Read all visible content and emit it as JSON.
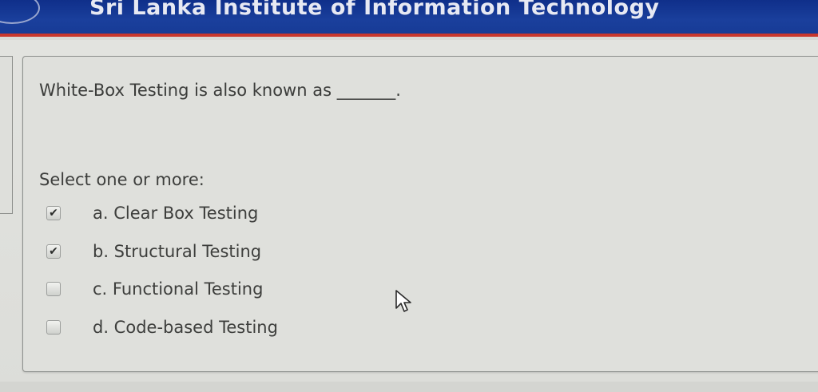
{
  "header": {
    "title": "Sri Lanka Institute of Information Technology"
  },
  "question": {
    "text": "White-Box Testing is also known as _______."
  },
  "answer": {
    "prompt": "Select one or more:",
    "options": [
      {
        "label": "a. Clear Box Testing",
        "checked": true
      },
      {
        "label": "b. Structural Testing",
        "checked": true
      },
      {
        "label": "c. Functional Testing",
        "checked": false
      },
      {
        "label": "d. Code-based Testing",
        "checked": false
      }
    ]
  },
  "colors": {
    "header_bg": "#1a3f9c",
    "header_accent": "#c8372d",
    "card_bg": "#dfe0dc"
  },
  "icons": {
    "checkmark": "checkmark-icon",
    "cursor": "mouse-pointer-icon"
  }
}
